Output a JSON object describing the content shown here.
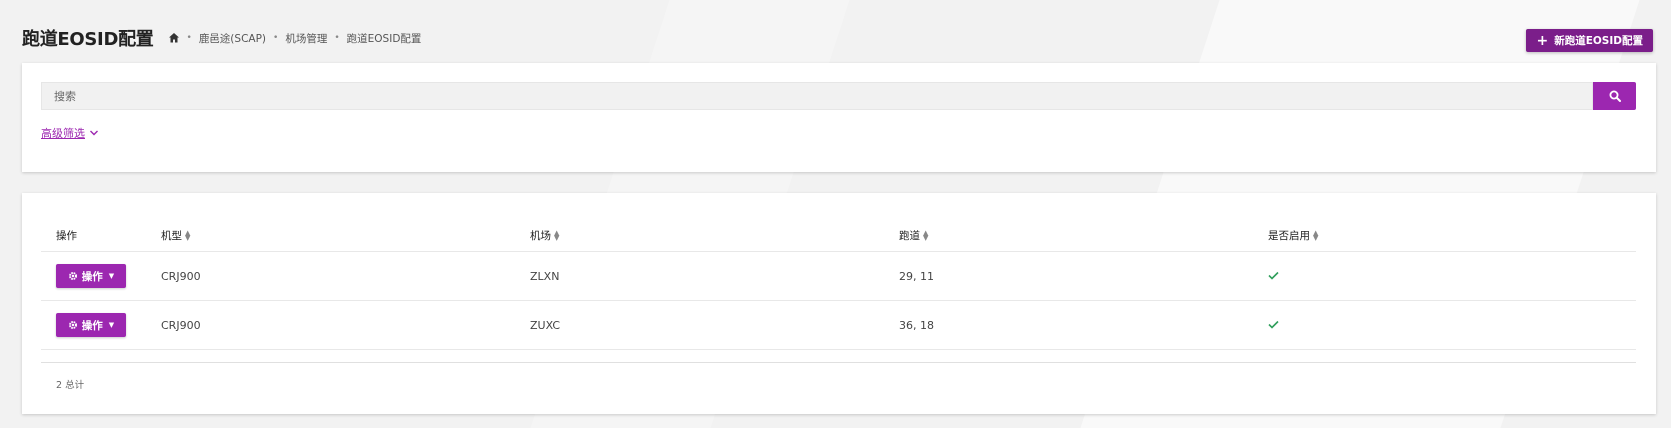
{
  "header": {
    "title": "跑道EOSID配置",
    "breadcrumb": [
      "鹿邑途(SCAP)",
      "机场管理",
      "跑道EOSID配置"
    ],
    "new_button_label": "新跑道EOSID配置"
  },
  "search": {
    "placeholder": "搜索",
    "advanced_filter_label": "高级筛选"
  },
  "table": {
    "columns": [
      "操作",
      "机型",
      "机场",
      "跑道",
      "是否启用"
    ],
    "rows": [
      {
        "action_label": "操作",
        "aircraft_type": "CRJ900",
        "airport": "ZLXN",
        "runway": "29, 11",
        "enabled": true
      },
      {
        "action_label": "操作",
        "aircraft_type": "CRJ900",
        "airport": "ZUXC",
        "runway": "36, 18",
        "enabled": true
      }
    ],
    "total_label": "2 总计"
  },
  "colors": {
    "accent": "#9c27b0",
    "accent_dark": "#7b1e8a",
    "check": "#2e9e5b"
  },
  "icons": {
    "home": "home-icon",
    "plus": "plus-icon",
    "search": "search-icon",
    "gear": "gear-icon",
    "caret": "caret-down-icon",
    "chevron": "chevron-down-icon",
    "check": "check-icon",
    "sort": "sort-icon"
  }
}
